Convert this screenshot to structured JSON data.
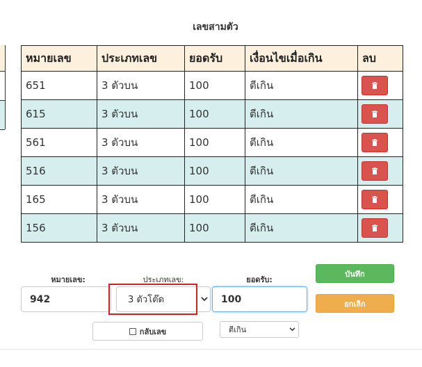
{
  "section_title": "เลขสามตัว",
  "table": {
    "headers": [
      "หมายเลข",
      "ประเภทเลข",
      "ยอดรับ",
      "เงื่อนไขเมื่อเกิน",
      "ลบ"
    ],
    "rows": [
      {
        "number": "651",
        "type": "3 ตัวบน",
        "amount": "100",
        "condition": "ตีเกิน"
      },
      {
        "number": "615",
        "type": "3 ตัวบน",
        "amount": "100",
        "condition": "ตีเกิน"
      },
      {
        "number": "561",
        "type": "3 ตัวบน",
        "amount": "100",
        "condition": "ตีเกิน"
      },
      {
        "number": "516",
        "type": "3 ตัวบน",
        "amount": "100",
        "condition": "ตีเกิน"
      },
      {
        "number": "165",
        "type": "3 ตัวบน",
        "amount": "100",
        "condition": "ตีเกิน"
      },
      {
        "number": "156",
        "type": "3 ตัวบน",
        "amount": "100",
        "condition": "ตีเกิน"
      }
    ]
  },
  "form": {
    "number_label": "หมายเลข:",
    "number_value": "942",
    "type_label": "ประเภทเลข:",
    "type_value": "3 ตัวโต๊ด",
    "amount_label": "ยอดรับ:",
    "amount_value": "100",
    "reverse_label": "กลับเลข",
    "condition_value": "ตีเกิน",
    "save_label": "บันทึก",
    "cancel_label": "ยกเลิก"
  },
  "colors": {
    "header_bg": "#fdf1de",
    "row_alt_bg": "#d7eeee",
    "delete_red": "#d9534f",
    "save_green": "#5cb85c",
    "cancel_orange": "#f0ad4e",
    "highlight_red": "#d62020"
  },
  "icons": {
    "delete": "trash-icon",
    "dropdown": "chevron-down-icon"
  }
}
